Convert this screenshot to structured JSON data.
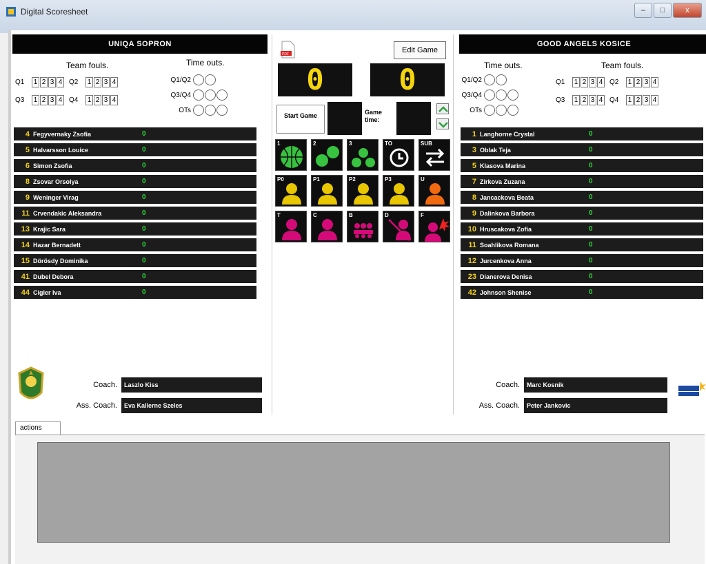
{
  "window": {
    "title": "Digital Scoresheet",
    "min_label": "–",
    "max_label": "□",
    "close_label": "x"
  },
  "home": {
    "name": "UNIQA SOPRON",
    "fouls_label": "Team fouls.",
    "timeouts_label": "Time outs.",
    "q1": "Q1",
    "q2": "Q2",
    "q3": "Q3",
    "q4": "Q4",
    "to1": "Q1/Q2",
    "to2": "Q3/Q4",
    "to3": "OTs",
    "players": [
      {
        "num": "4",
        "name": "Fegyvernaky Zsofia",
        "pts": "0"
      },
      {
        "num": "5",
        "name": "Halvarsson Louice",
        "pts": "0"
      },
      {
        "num": "6",
        "name": "Simon Zsofia",
        "pts": "0"
      },
      {
        "num": "8",
        "name": "Zsovar Orsolya",
        "pts": "0"
      },
      {
        "num": "9",
        "name": "Weninger Virag",
        "pts": "0"
      },
      {
        "num": "11",
        "name": "Crvendakic Aleksandra",
        "pts": "0"
      },
      {
        "num": "13",
        "name": "Krajic Sara",
        "pts": "0"
      },
      {
        "num": "14",
        "name": "Hazar Bernadett",
        "pts": "0"
      },
      {
        "num": "15",
        "name": "Dörösdy Dominika",
        "pts": "0"
      },
      {
        "num": "41",
        "name": "Dubel Debora",
        "pts": "0"
      },
      {
        "num": "44",
        "name": "Cigler Iva",
        "pts": "0"
      }
    ],
    "coach_label": "Coach.",
    "coach": "Laszlo Kiss",
    "asst_label": "Ass. Coach.",
    "asst": "Eva Kallerne Szeles"
  },
  "away": {
    "name": "GOOD ANGELS KOSICE",
    "fouls_label": "Team fouls.",
    "timeouts_label": "Time outs.",
    "q1": "Q1",
    "q2": "Q2",
    "q3": "Q3",
    "q4": "Q4",
    "to1": "Q1/Q2",
    "to2": "Q3/Q4",
    "to3": "OTs",
    "players": [
      {
        "num": "1",
        "name": "Langhorne Crystal",
        "pts": "0"
      },
      {
        "num": "3",
        "name": "Oblak Teja",
        "pts": "0"
      },
      {
        "num": "5",
        "name": "Klasova Marina",
        "pts": "0"
      },
      {
        "num": "7",
        "name": "Zirkova Zuzana",
        "pts": "0"
      },
      {
        "num": "8",
        "name": "Jancackova Beata",
        "pts": "0"
      },
      {
        "num": "9",
        "name": "Dalinkova Barbora",
        "pts": "0"
      },
      {
        "num": "10",
        "name": "Hruscakova Zofia",
        "pts": "0"
      },
      {
        "num": "11",
        "name": "Soahlikova Romana",
        "pts": "0"
      },
      {
        "num": "12",
        "name": "Jurcenkova Anna",
        "pts": "0"
      },
      {
        "num": "23",
        "name": "Dianerova Denisa",
        "pts": "0"
      },
      {
        "num": "42",
        "name": "Johnson Shenise",
        "pts": "0"
      }
    ],
    "coach_label": "Coach.",
    "coach": "Marc Kosnik",
    "asst_label": "Ass. Coach.",
    "asst": "Peter Jankovic"
  },
  "center": {
    "edit_game": "Edit Game",
    "home_score": "0",
    "away_score": "0",
    "start_game": "Start Game",
    "game_time": "Game time:",
    "shot1_label": "1",
    "shot2_label": "2",
    "shot3_label": "3",
    "to_label": "TO",
    "sub_label": "SUB",
    "p0": "P0",
    "p1": "P1",
    "p2": "P2",
    "p3": "P3",
    "u": "U",
    "t": "T",
    "c": "C",
    "b": "B",
    "d": "D",
    "f": "F"
  },
  "actions": {
    "tab": "actions"
  },
  "colors": {
    "score": "#f4d40d",
    "points": "#2ed43a",
    "number": "#f3d21a",
    "foul_yellow": "#e8c600",
    "foul_magenta": "#d40a78",
    "foul_orange": "#f26a10"
  }
}
